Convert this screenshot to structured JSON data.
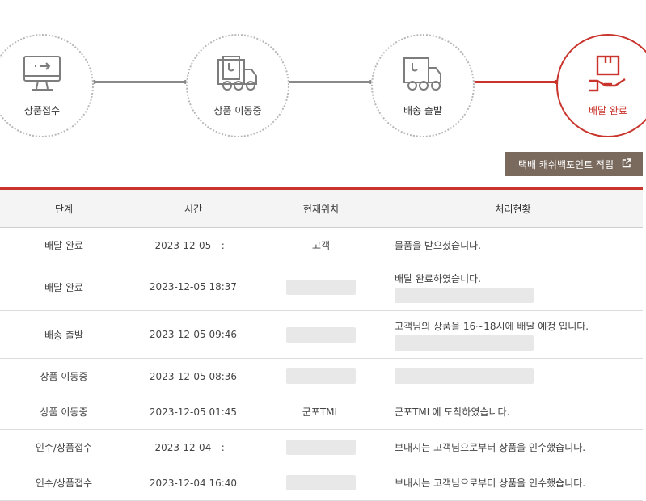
{
  "steps": [
    {
      "label": "상품접수",
      "icon": "monitor-arrow-icon",
      "active": false
    },
    {
      "label": "상품 이동중",
      "icon": "box-truck-icon",
      "active": false
    },
    {
      "label": "배송 출발",
      "icon": "delivery-truck-icon",
      "active": false
    },
    {
      "label": "배달 완료",
      "icon": "hand-package-icon",
      "active": true
    }
  ],
  "colors": {
    "accent": "#c9342c",
    "connector": "#8a8a8a",
    "button_bg": "#7a6a5e"
  },
  "cashback_button": {
    "label": "택배 캐쉬백포인트 적립",
    "icon": "external-link-icon"
  },
  "table": {
    "headers": [
      "단계",
      "시간",
      "현재위치",
      "처리현황"
    ],
    "rows": [
      {
        "stage": "배달 완료",
        "time": "2023-12-05 --:--",
        "location": "고객",
        "status": "물품을 받으셨습니다."
      },
      {
        "stage": "배달 완료",
        "time": "2023-12-05 18:37",
        "location": "",
        "status": "배달 완료하였습니다."
      },
      {
        "stage": "배송 출발",
        "time": "2023-12-05 09:46",
        "location": "",
        "status": "고객님의 상품을 16~18시에 배달 예정 입니다."
      },
      {
        "stage": "상품 이동중",
        "time": "2023-12-05 08:36",
        "location": "",
        "status": ""
      },
      {
        "stage": "상품 이동중",
        "time": "2023-12-05 01:45",
        "location": "군포TML",
        "status": "군포TML에 도착하였습니다."
      },
      {
        "stage": "인수/상품접수",
        "time": "2023-12-04 --:--",
        "location": "",
        "status": "보내시는 고객님으로부터 상품을 인수했습니다."
      },
      {
        "stage": "인수/상품접수",
        "time": "2023-12-04 16:40",
        "location": "",
        "status": "보내시는 고객님으로부터 상품을 인수했습니다."
      }
    ]
  }
}
